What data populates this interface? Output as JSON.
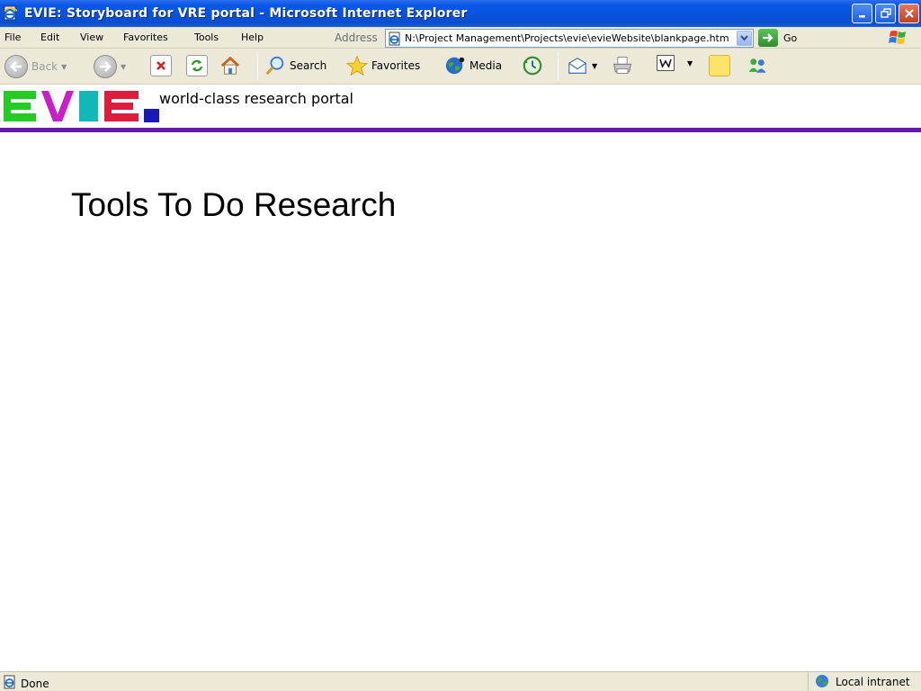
{
  "window": {
    "title": "EVIE: Storyboard for VRE portal - Microsoft Internet Explorer"
  },
  "menu": {
    "items": [
      "File",
      "Edit",
      "View",
      "Favorites",
      "Tools",
      "Help"
    ]
  },
  "address": {
    "label": "Address",
    "value": "N:\\Project Management\\Projects\\evie\\evieWebsite\\blankpage.htm",
    "go_label": "Go"
  },
  "toolbar": {
    "back_label": "Back",
    "search_label": "Search",
    "favorites_label": "Favorites",
    "media_label": "Media"
  },
  "site": {
    "logo_text": "EVIE",
    "tagline": "world-class research portal",
    "page_heading": "Tools To Do Research"
  },
  "status": {
    "left_text": "Done",
    "zone_text": "Local intranet"
  },
  "colors": {
    "logo_e1": "#22cc22",
    "logo_v": "#c81fc8",
    "logo_i": "#12b8b8",
    "logo_e2": "#e01c3c",
    "logo_dot": "#1a1ab8",
    "header_rule": "#6418a8",
    "xp_titlebar": "#0a56e8"
  }
}
